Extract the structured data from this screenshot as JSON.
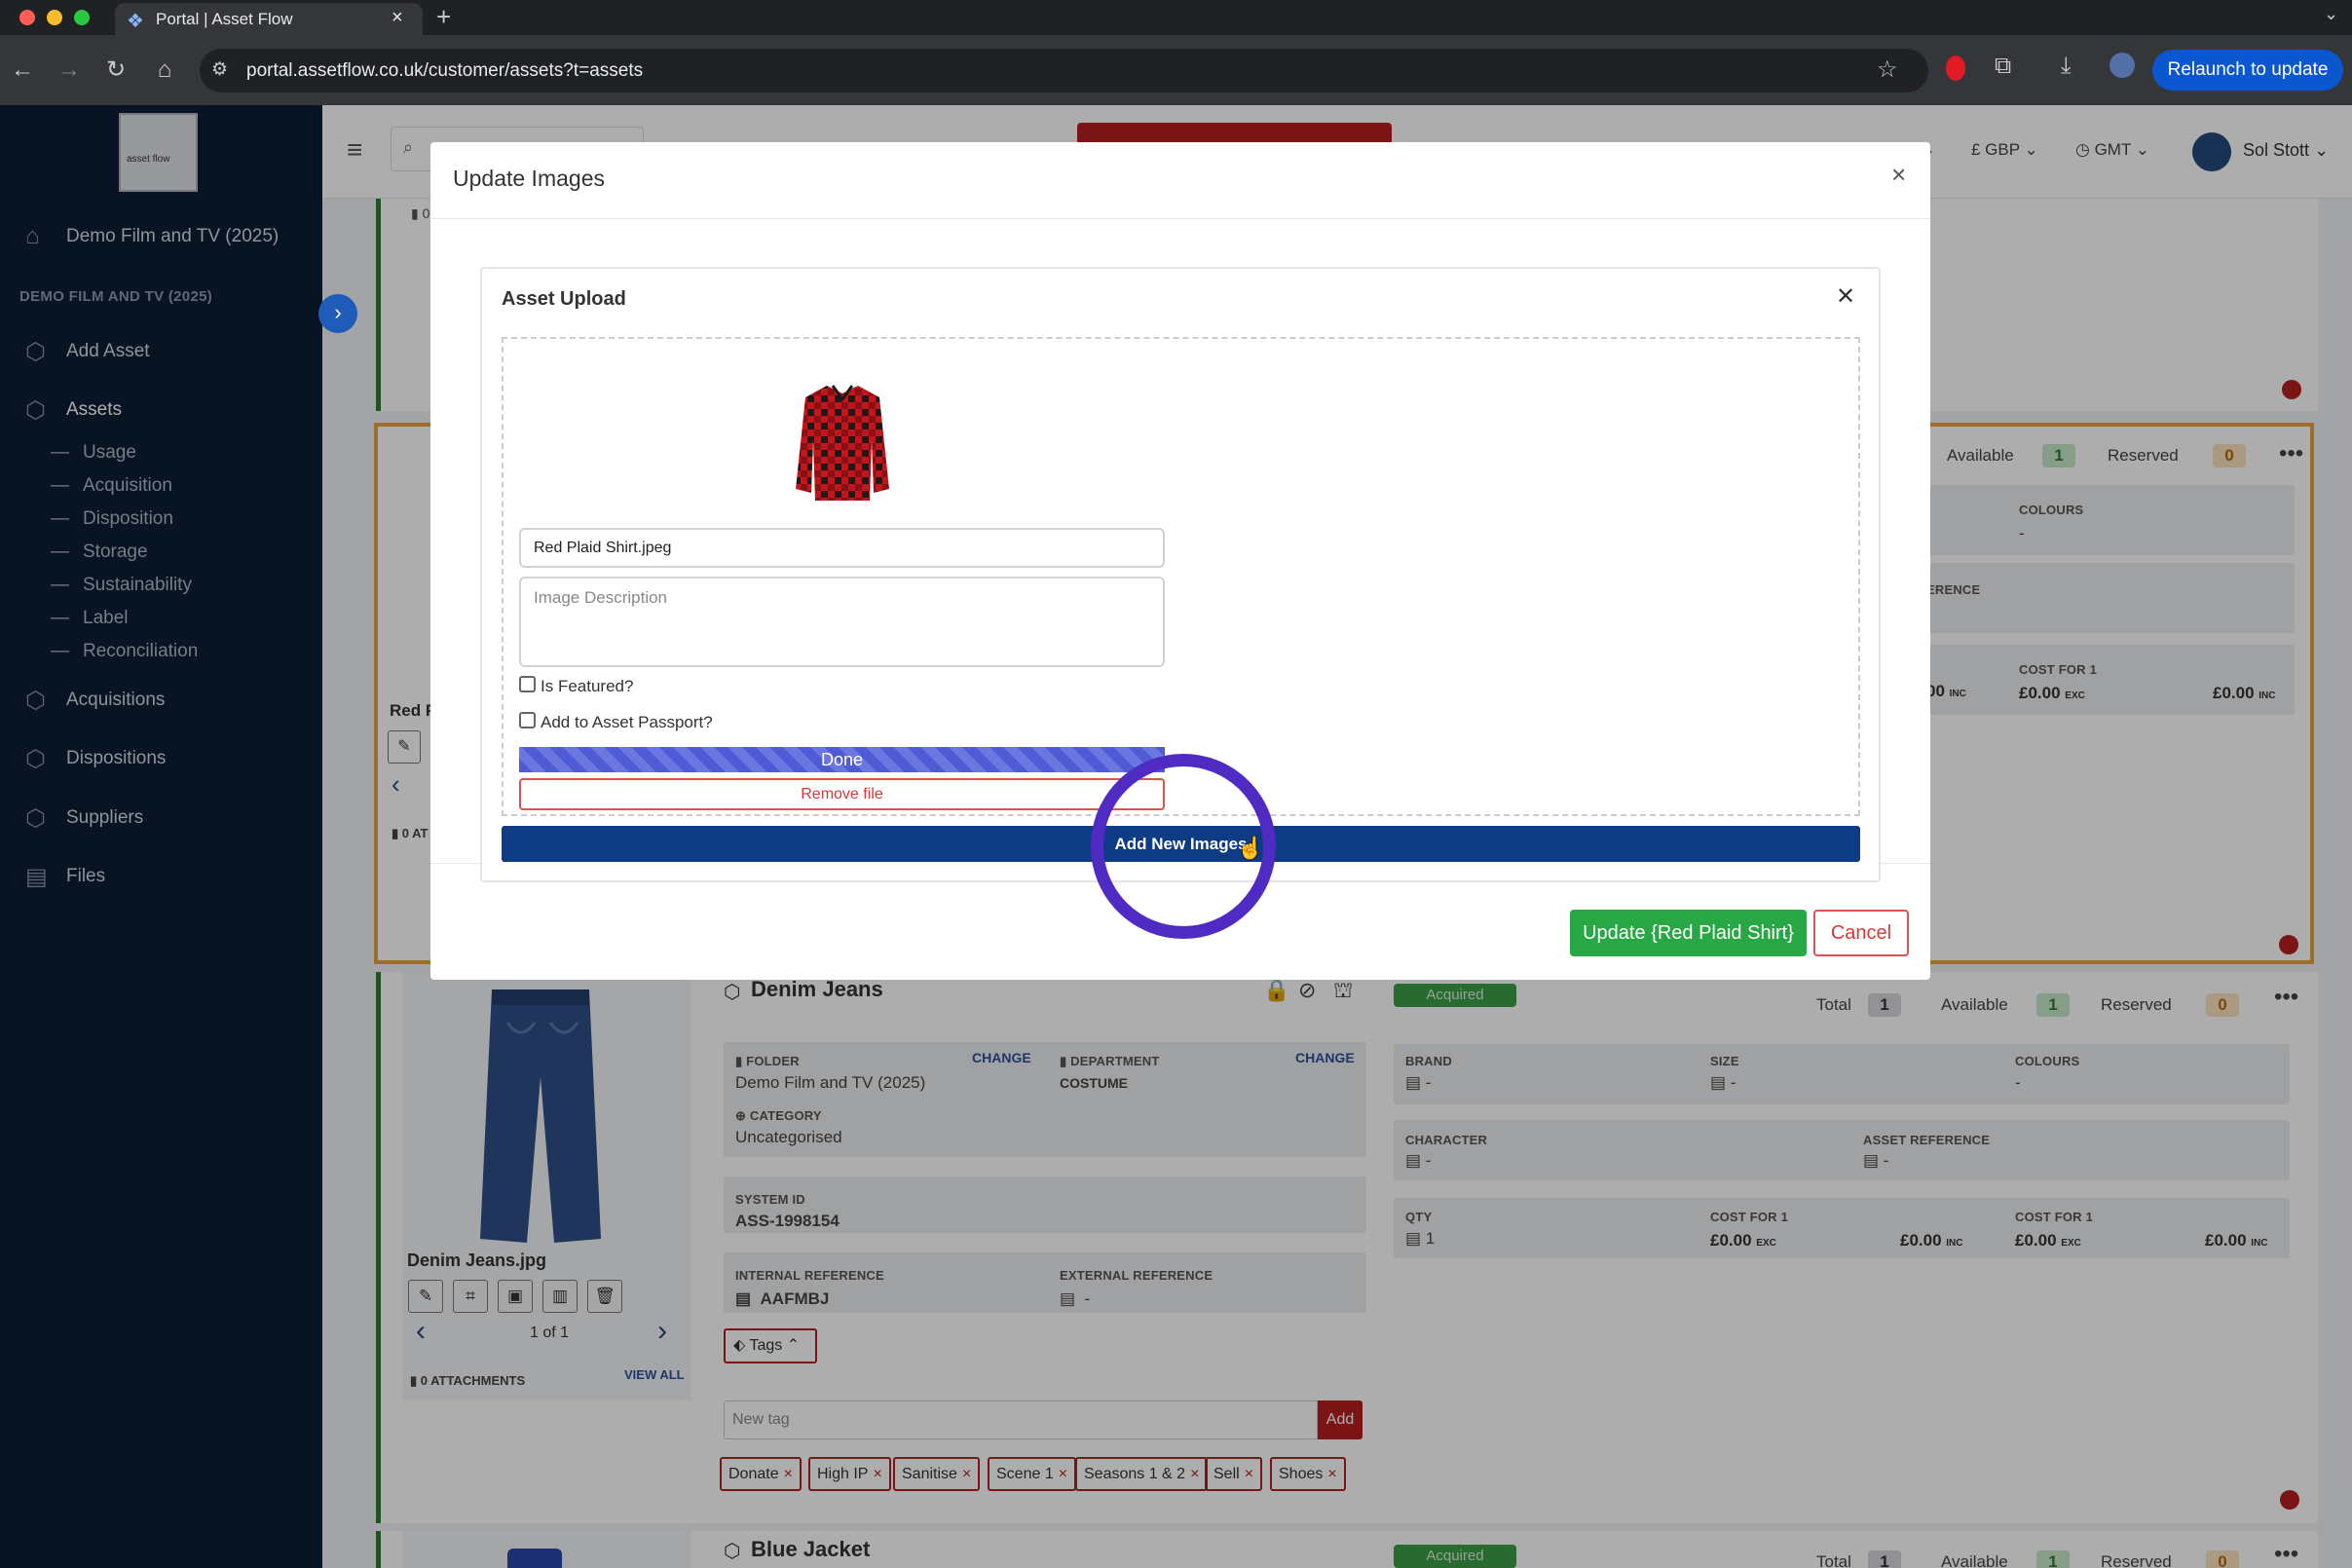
{
  "browser": {
    "tab_title": "Portal | Asset Flow",
    "url": "portal.assetflow.co.uk/customer/assets?t=assets",
    "relaunch_label": "Relaunch to update"
  },
  "sidebar": {
    "logo_text": "asset flow",
    "home_label": "Demo Film and TV (2025)",
    "section_label": "DEMO FILM AND TV (2025)",
    "items": [
      {
        "label": "Add Asset",
        "icon": "cube-icon"
      },
      {
        "label": "Assets",
        "icon": "cube-icon"
      },
      {
        "label": "Acquisitions",
        "icon": "cube-icon"
      },
      {
        "label": "Dispositions",
        "icon": "cube-icon"
      },
      {
        "label": "Suppliers",
        "icon": "cube-icon"
      },
      {
        "label": "Files",
        "icon": "file-icon"
      }
    ],
    "sub_items": [
      "Usage",
      "Acquisition",
      "Disposition",
      "Storage",
      "Sustainability",
      "Label",
      "Reconciliation"
    ]
  },
  "topbar": {
    "currency": "£ GBP",
    "timezone": "GMT",
    "user_name": "Sol Stott"
  },
  "background_card_top": {
    "attachments_prefix": "0",
    "title_fragment": "Red P",
    "attachments_fragment": "0 AT",
    "available_label": "Available",
    "available_value": "1",
    "reserved_label": "Reserved",
    "reserved_value": "0",
    "colours_label": "COLOURS",
    "colours_value": "-",
    "reference_fragment": "ERENCE",
    "cost_label": "COST FOR 1",
    "cost_inc_a": "00",
    "cost_exc": "£0.00",
    "cost_inc_b": "£0.00",
    "exc_suffix": "EXC",
    "inc_suffix": "INC"
  },
  "asset_card": {
    "title": "Denim Jeans",
    "status": "Acquired",
    "total_label": "Total",
    "total_value": "1",
    "available_label": "Available",
    "available_value": "1",
    "reserved_label": "Reserved",
    "reserved_value": "0",
    "image_filename": "Denim Jeans.jpg",
    "pager": "1 of 1",
    "attachments_label": "0 ATTACHMENTS",
    "view_all_label": "VIEW ALL",
    "folder_label": "FOLDER",
    "folder_value": "Demo Film and TV (2025)",
    "change_label": "CHANGE",
    "department_label": "DEPARTMENT",
    "department_value": "COSTUME",
    "category_label": "CATEGORY",
    "category_value": "Uncategorised",
    "system_id_label": "SYSTEM ID",
    "system_id_value": "ASS-1998154",
    "internal_ref_label": "INTERNAL REFERENCE",
    "internal_ref_value": "AAFMBJ",
    "external_ref_label": "EXTERNAL REFERENCE",
    "external_ref_value": "-",
    "tags_label": "Tags",
    "new_tag_placeholder": "New tag",
    "add_label": "Add",
    "tags": [
      "Donate",
      "High IP",
      "Sanitise",
      "Scene 1",
      "Seasons 1 & 2",
      "Sell",
      "Shoes"
    ],
    "brand_label": "BRAND",
    "brand_value": "-",
    "size_label": "SIZE",
    "size_value": "-",
    "colours_label": "COLOURS",
    "colours_value": "-",
    "character_label": "CHARACTER",
    "character_value": "-",
    "asset_ref_label": "ASSET REFERENCE",
    "asset_ref_value": "-",
    "qty_label": "QTY",
    "qty_value": "1",
    "cost_label": "COST FOR 1",
    "cost_exc_1": "£0.00",
    "cost_inc_1": "£0.00",
    "cost_exc_2": "£0.00",
    "cost_inc_2": "£0.00",
    "exc_suffix": "EXC",
    "inc_suffix": "INC"
  },
  "next_card": {
    "title": "Blue Jacket",
    "status": "Acquired",
    "total_label": "Total",
    "total_value": "1",
    "available_label": "Available",
    "available_value": "1",
    "reserved_label": "Reserved",
    "reserved_value": "0"
  },
  "modal": {
    "title": "Update Images",
    "close": "×",
    "upload_title": "Asset Upload",
    "upload_close": "✕",
    "filename": "Red Plaid Shirt.jpeg",
    "description_placeholder": "Image Description",
    "is_featured_label": "Is Featured?",
    "passport_label": "Add to Asset Passport?",
    "upload_progress": 1.0,
    "done_label": "Done",
    "remove_label": "Remove file",
    "add_new_label": "Add New Images",
    "update_label": "Update {Red Plaid Shirt}",
    "cancel_label": "Cancel"
  },
  "colors": {
    "sidebar_bg": "#0d1d34",
    "primary": "#0d3b84",
    "success": "#28a745",
    "danger": "#b51f1f",
    "highlight_ring": "#4f2bc4",
    "selected_card_border": "#e8a23a"
  }
}
